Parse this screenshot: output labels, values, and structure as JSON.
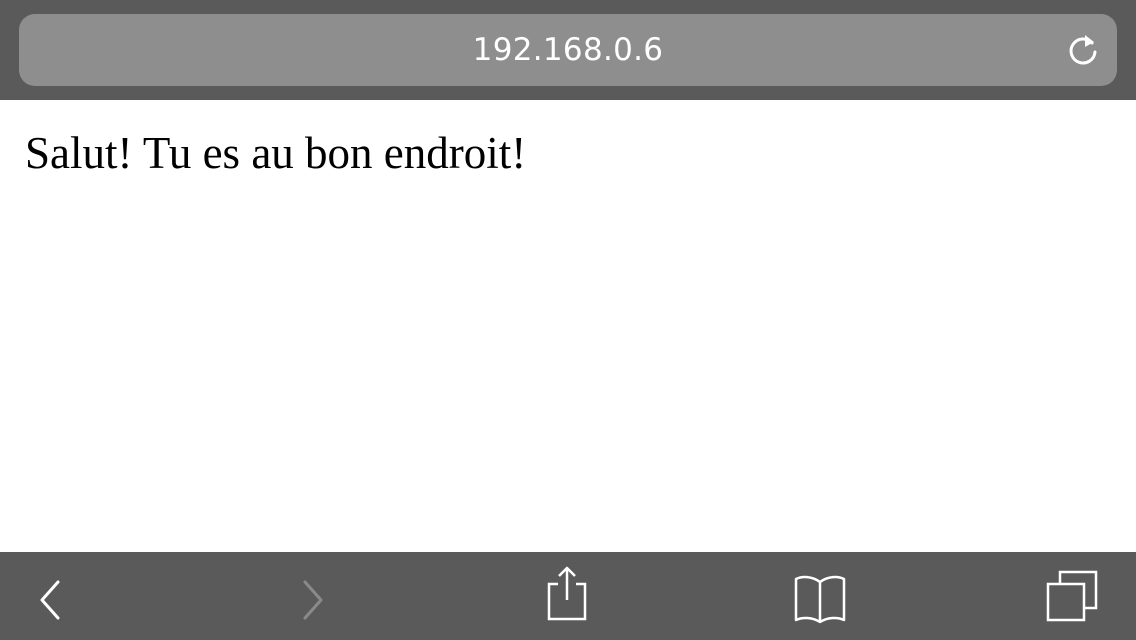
{
  "browser": {
    "url": "192.168.0.6",
    "reload_icon": "reload-icon"
  },
  "page": {
    "text": "Salut! Tu es au bon endroit!"
  },
  "toolbar": {
    "items": [
      {
        "name": "back",
        "icon": "chevron-left-icon",
        "enabled": true
      },
      {
        "name": "forward",
        "icon": "chevron-right-icon",
        "enabled": false
      },
      {
        "name": "share",
        "icon": "share-icon",
        "enabled": true
      },
      {
        "name": "bookmarks",
        "icon": "book-icon",
        "enabled": true
      },
      {
        "name": "tabs",
        "icon": "tabs-icon",
        "enabled": true
      }
    ]
  },
  "colors": {
    "bar_background": "#5a5a5a",
    "address_field": "#8e8e8e",
    "icon_enabled": "#ffffff",
    "icon_disabled": "#8a8a8a"
  }
}
